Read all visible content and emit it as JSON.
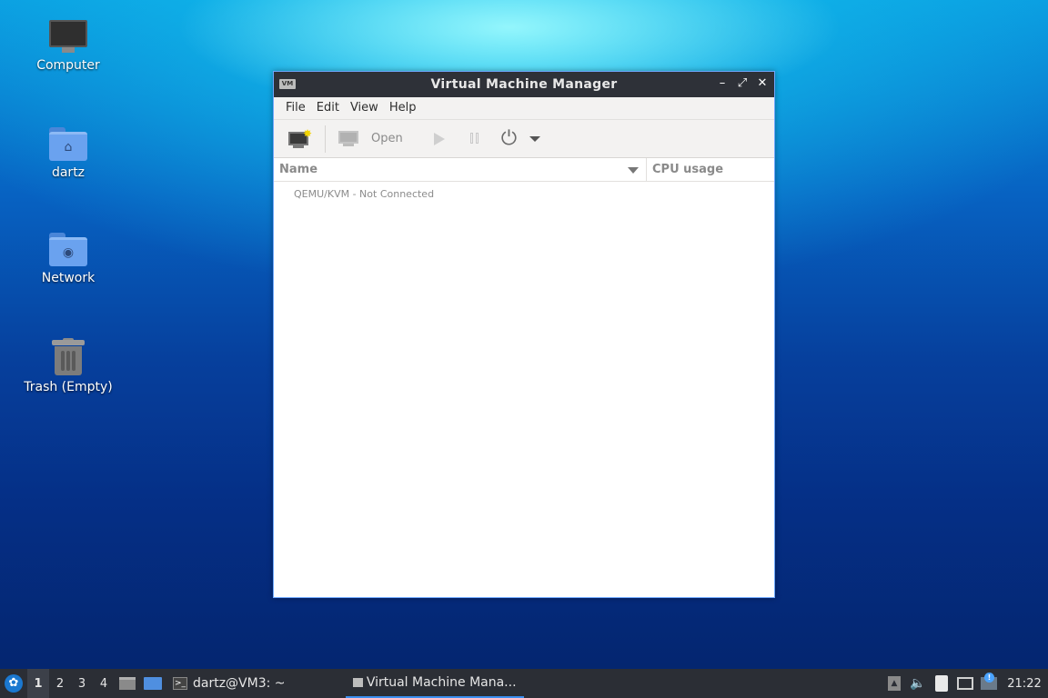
{
  "desktop": {
    "icons": [
      {
        "label": "Computer"
      },
      {
        "label": "dartz"
      },
      {
        "label": "Network"
      },
      {
        "label": "Trash (Empty)"
      }
    ]
  },
  "window": {
    "title": "Virtual Machine Manager",
    "app_icon_text": "VM",
    "controls": {
      "minimize": "–",
      "maximize": "⤢",
      "close": "✕"
    },
    "menu": [
      "File",
      "Edit",
      "View",
      "Help"
    ],
    "toolbar": {
      "open_label": "Open"
    },
    "columns": {
      "name": "Name",
      "cpu": "CPU usage"
    },
    "connections": [
      {
        "label": "QEMU/KVM - Not Connected"
      }
    ]
  },
  "taskbar": {
    "workspaces": [
      "1",
      "2",
      "3",
      "4"
    ],
    "active_workspace": "1",
    "tasks": [
      {
        "label": "dartz@VM3: ~"
      },
      {
        "label": "Virtual Machine Mana..."
      }
    ],
    "clock": "21:22"
  },
  "colors": {
    "titlebar": "#2e3138",
    "taskbar": "#2b2e35",
    "accent": "#3c8ff0",
    "window_border": "#6ea8ff"
  },
  "icons": {
    "start": "lxqt-logo-icon",
    "files": "file-manager-icon",
    "desktop": "show-desktop-icon",
    "terminal": "terminal-icon",
    "volume": "volume-icon",
    "clipboard": "clipboard-icon",
    "network": "network-icon",
    "notifications": "notification-icon"
  }
}
